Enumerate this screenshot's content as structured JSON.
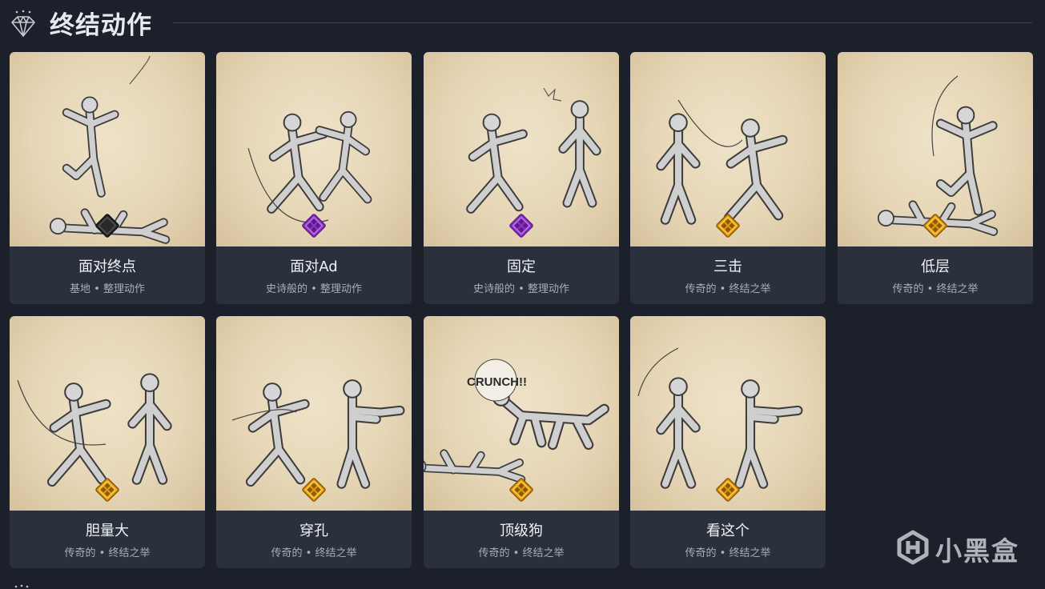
{
  "section": {
    "title": "终结动作",
    "icon": "diamond-icon"
  },
  "cards": [
    {
      "name": "面对终点",
      "subtitle": "基地 • 整理动作",
      "rarity": "base",
      "rarity_icon": "rarity-base-icon",
      "art": "finisher-illustration-stomp"
    },
    {
      "name": "面对Ad",
      "subtitle": "史诗般的 • 整理动作",
      "rarity": "epic",
      "rarity_icon": "rarity-epic-icon",
      "art": "finisher-illustration-slam"
    },
    {
      "name": "固定",
      "subtitle": "史诗般的 • 整理动作",
      "rarity": "epic",
      "rarity_icon": "rarity-epic-icon",
      "art": "finisher-illustration-punch"
    },
    {
      "name": "三击",
      "subtitle": "传奇的 • 终结之举",
      "rarity": "legendary",
      "rarity_icon": "rarity-legendary-icon",
      "art": "finisher-illustration-triple-strike"
    },
    {
      "name": "低层",
      "subtitle": "传奇的 • 终结之举",
      "rarity": "legendary",
      "rarity_icon": "rarity-legendary-icon",
      "art": "finisher-illustration-ground-stab"
    },
    {
      "name": "胆量大",
      "subtitle": "传奇的 • 终结之举",
      "rarity": "legendary",
      "rarity_icon": "rarity-legendary-icon",
      "art": "finisher-illustration-knife-grab"
    },
    {
      "name": "穿孔",
      "subtitle": "传奇的 • 终结之举",
      "rarity": "legendary",
      "rarity_icon": "rarity-legendary-icon",
      "art": "finisher-illustration-throw"
    },
    {
      "name": "顶级狗",
      "subtitle": "传奇的 • 终结之举",
      "rarity": "legendary",
      "rarity_icon": "rarity-legendary-icon",
      "art": "finisher-illustration-dog",
      "art_text": "CRUNCH!!"
    },
    {
      "name": "看这个",
      "subtitle": "传奇的 • 终结之举",
      "rarity": "legendary",
      "rarity_icon": "rarity-legendary-icon",
      "art": "finisher-illustration-disarm"
    }
  ],
  "watermark": {
    "text": "小黑盒",
    "icon": "xiaoheihe-logo-icon"
  },
  "colors": {
    "background": "#1b202a",
    "card": "#2a303c",
    "parchment": "#e6d6b6",
    "epic": "#a64dd6",
    "legendary": "#e8a21a",
    "base": "#2b2b2b"
  }
}
